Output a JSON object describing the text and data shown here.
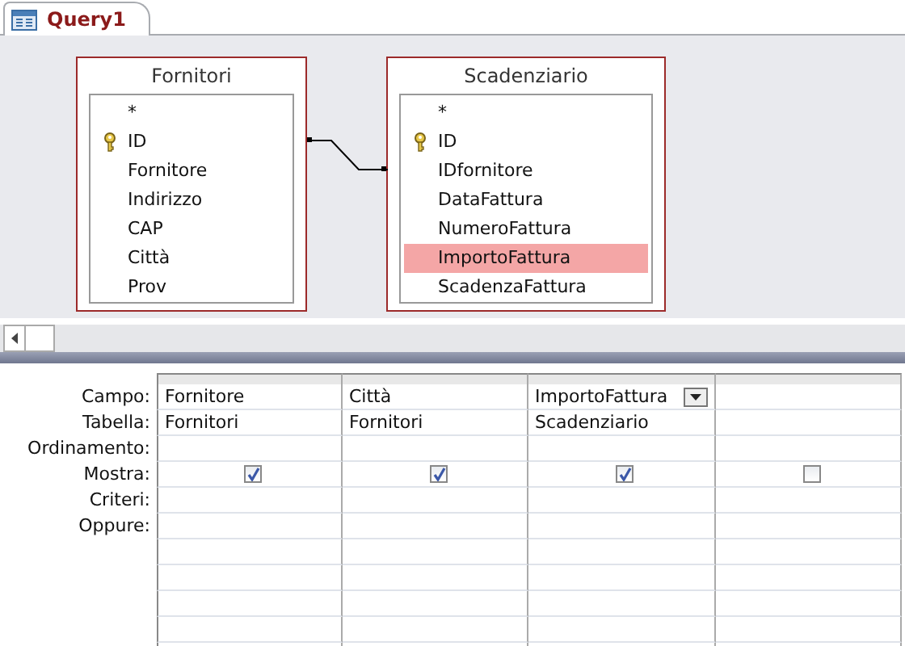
{
  "tab": {
    "label": "Query1",
    "selected": true
  },
  "tables": [
    {
      "title": "Fornitori",
      "fields": [
        {
          "name": "*",
          "key": false,
          "selected": false
        },
        {
          "name": "ID",
          "key": true,
          "selected": false
        },
        {
          "name": "Fornitore",
          "key": false,
          "selected": false
        },
        {
          "name": "Indirizzo",
          "key": false,
          "selected": false
        },
        {
          "name": "CAP",
          "key": false,
          "selected": false
        },
        {
          "name": "Città",
          "key": false,
          "selected": false
        },
        {
          "name": "Prov",
          "key": false,
          "selected": false
        }
      ]
    },
    {
      "title": "Scadenziario",
      "fields": [
        {
          "name": "*",
          "key": false,
          "selected": false
        },
        {
          "name": "ID",
          "key": true,
          "selected": false
        },
        {
          "name": "IDfornitore",
          "key": false,
          "selected": false
        },
        {
          "name": "DataFattura",
          "key": false,
          "selected": false
        },
        {
          "name": "NumeroFattura",
          "key": false,
          "selected": false
        },
        {
          "name": "ImportoFattura",
          "key": false,
          "selected": true
        },
        {
          "name": "ScadenzaFattura",
          "key": false,
          "selected": false
        }
      ]
    }
  ],
  "grid": {
    "row_labels": [
      "Campo:",
      "Tabella:",
      "Ordinamento:",
      "Mostra:",
      "Criteri:",
      "Oppure:"
    ],
    "columns": [
      {
        "field": "Fornitore",
        "table": "Fornitori",
        "show": true,
        "dropdown": false
      },
      {
        "field": "Città",
        "table": "Fornitori",
        "show": true,
        "dropdown": false
      },
      {
        "field": "ImportoFattura",
        "table": "Scadenziario",
        "show": true,
        "dropdown": true
      },
      {
        "show": false,
        "dropdown": false
      }
    ]
  }
}
